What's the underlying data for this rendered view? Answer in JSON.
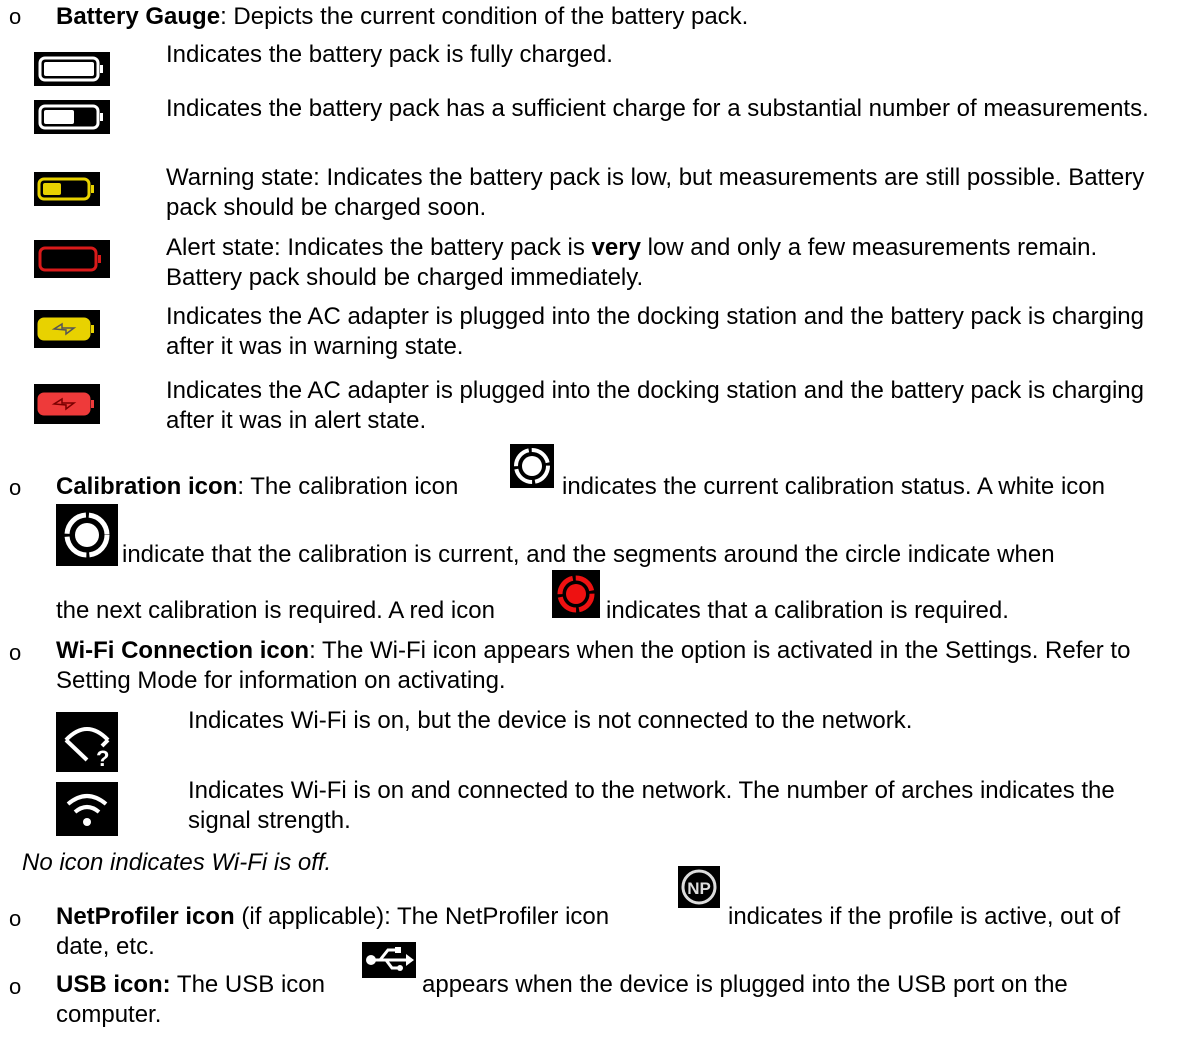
{
  "battery": {
    "title": "Battery Gauge",
    "desc": ": Depicts the current condition of the battery pack.",
    "items": [
      {
        "icon": "battery-full-icon",
        "text": "Indicates the battery pack is fully charged."
      },
      {
        "icon": "battery-half-icon",
        "text": "Indicates the battery pack has a sufficient charge for a substantial number of measurements."
      },
      {
        "icon": "battery-warning-icon",
        "text": "Warning state: Indicates the battery pack is low, but measurements are still possible. Battery pack should be charged soon."
      },
      {
        "icon": "battery-alert-icon",
        "pre": "Alert state: Indicates the battery pack is ",
        "bold": "very",
        "post": " low and only a few measurements remain. Battery pack should be charged immediately."
      },
      {
        "icon": "battery-charging-warning-icon",
        "text": "Indicates the AC adapter is plugged into the docking station and the battery pack is charging after it was in warning state."
      },
      {
        "icon": "battery-charging-alert-icon",
        "text": "Indicates the AC adapter is plugged into the docking station and the battery pack is charging after it was in alert state."
      }
    ]
  },
  "calibration": {
    "title": "Calibration icon",
    "line1a": ": The calibration icon",
    "line1b": "indicates the current calibration status. A white icon",
    "line2": "indicate that the calibration is current, and the segments around the circle indicate when",
    "line3a": "the next calibration is required. A red icon",
    "line3b": "indicates that a calibration is required."
  },
  "wifi": {
    "title": "Wi-Fi Connection icon",
    "desc": ": The Wi-Fi icon appears when the option is activated in the Settings. Refer to Setting Mode for information on activating.",
    "items": [
      {
        "icon": "wifi-not-connected-icon",
        "text": "Indicates Wi-Fi is on, but the device is not connected to the network."
      },
      {
        "icon": "wifi-connected-icon",
        "text": "Indicates Wi-Fi is on and connected to the network. The number of arches indicates the signal strength."
      }
    ],
    "note": "No icon indicates Wi-Fi is off."
  },
  "netprofiler": {
    "title": "NetProfiler icon",
    "paren": " (if applicable): The NetProfiler icon",
    "rest": "indicates if the profile is active, out of date, etc."
  },
  "usb": {
    "title": "USB icon:",
    "pre": " The USB icon",
    "rest": "appears when the device is plugged into the USB port on the computer."
  },
  "bullet_char": "o"
}
